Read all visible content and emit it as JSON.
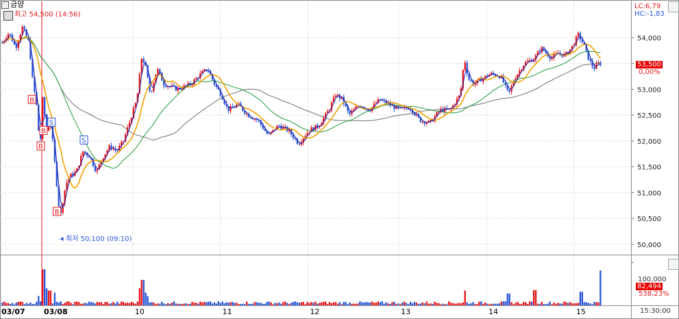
{
  "symbol": "금양",
  "high_label": "최고 54,500 (14:56)",
  "low_label": "최저 50,100 (09:10)",
  "lc_label": "LC:6,79",
  "hc_label": "HC:-1,83",
  "current_price": "53,500",
  "current_change": "0,00%",
  "volume_label": "82,494",
  "volume_ratio": "538,23%",
  "volume_axis_label": "100,000",
  "time_label": "15:30:00",
  "colors": {
    "up": "#e8151a",
    "down": "#2a56d8",
    "ma5": "#1a1aa8",
    "ma20": "#f0a000",
    "ma60": "#1e9a38",
    "ma120": "#707070",
    "grid": "#c6c6c6"
  },
  "chart_data": {
    "type": "candlestick",
    "title": "금양",
    "y_ticks": [
      "54,000",
      "53,500",
      "53,000",
      "52,500",
      "52,000",
      "51,500",
      "51,000",
      "50,500",
      "50,000"
    ],
    "y_values": [
      54000,
      53500,
      53000,
      52500,
      52000,
      51500,
      51000,
      50500,
      50000
    ],
    "ylim": [
      49800,
      54700
    ],
    "x_tick_labels": [
      "03/07",
      "03/08",
      "10",
      "11",
      "12",
      "13",
      "14",
      "15"
    ],
    "x_tick_times": [
      0,
      60,
      195,
      325,
      455,
      590,
      720,
      850
    ],
    "x_max": 900,
    "price_anchors": [
      [
        0,
        53900
      ],
      [
        10,
        54100
      ],
      [
        20,
        53800
      ],
      [
        30,
        54200
      ],
      [
        40,
        53900
      ],
      [
        45,
        53200
      ],
      [
        52,
        52600
      ],
      [
        56,
        51800
      ],
      [
        60,
        52800
      ],
      [
        66,
        52200
      ],
      [
        72,
        52400
      ],
      [
        80,
        51300
      ],
      [
        86,
        50500
      ],
      [
        92,
        51000
      ],
      [
        98,
        51300
      ],
      [
        110,
        51400
      ],
      [
        120,
        51800
      ],
      [
        130,
        51700
      ],
      [
        140,
        51400
      ],
      [
        150,
        51700
      ],
      [
        160,
        51900
      ],
      [
        170,
        51800
      ],
      [
        180,
        52000
      ],
      [
        190,
        52400
      ],
      [
        200,
        52800
      ],
      [
        207,
        53600
      ],
      [
        212,
        53500
      ],
      [
        220,
        52900
      ],
      [
        230,
        53400
      ],
      [
        240,
        53100
      ],
      [
        260,
        53000
      ],
      [
        280,
        53100
      ],
      [
        295,
        53300
      ],
      [
        305,
        53400
      ],
      [
        315,
        53100
      ],
      [
        325,
        52900
      ],
      [
        335,
        52600
      ],
      [
        350,
        52700
      ],
      [
        365,
        52500
      ],
      [
        380,
        52400
      ],
      [
        395,
        52100
      ],
      [
        410,
        52300
      ],
      [
        425,
        52200
      ],
      [
        440,
        51950
      ],
      [
        455,
        52200
      ],
      [
        470,
        52300
      ],
      [
        485,
        52600
      ],
      [
        495,
        52900
      ],
      [
        505,
        52800
      ],
      [
        515,
        52500
      ],
      [
        530,
        52700
      ],
      [
        545,
        52600
      ],
      [
        560,
        52800
      ],
      [
        575,
        52700
      ],
      [
        590,
        52600
      ],
      [
        605,
        52650
      ],
      [
        620,
        52400
      ],
      [
        635,
        52350
      ],
      [
        650,
        52600
      ],
      [
        665,
        52600
      ],
      [
        680,
        52900
      ],
      [
        686,
        53600
      ],
      [
        692,
        53200
      ],
      [
        700,
        53100
      ],
      [
        712,
        53200
      ],
      [
        725,
        53300
      ],
      [
        740,
        53250
      ],
      [
        752,
        52900
      ],
      [
        760,
        53200
      ],
      [
        775,
        53500
      ],
      [
        790,
        53600
      ],
      [
        800,
        53800
      ],
      [
        815,
        53600
      ],
      [
        825,
        53700
      ],
      [
        835,
        53650
      ],
      [
        845,
        53800
      ],
      [
        855,
        54050
      ],
      [
        862,
        53900
      ],
      [
        870,
        53600
      ],
      [
        878,
        53400
      ],
      [
        885,
        53500
      ],
      [
        890,
        53500
      ]
    ],
    "high_point": {
      "t": 856,
      "price": 54500
    },
    "low_point": {
      "t": 86,
      "price": 50100
    },
    "signals": [
      {
        "t": 45,
        "type": "B"
      },
      {
        "t": 58,
        "type": "B"
      },
      {
        "t": 74,
        "type": "S"
      },
      {
        "t": 62,
        "type": "B"
      },
      {
        "t": 82,
        "type": "B"
      },
      {
        "t": 122,
        "type": "S"
      }
    ],
    "volume_ylim": [
      0,
      110000
    ],
    "volume_spikes": [
      [
        62,
        85000
      ],
      [
        60,
        55000
      ],
      [
        66,
        40000
      ],
      [
        70,
        35000
      ],
      [
        78,
        30000
      ],
      [
        54,
        22000
      ],
      [
        208,
        60000
      ],
      [
        205,
        40000
      ],
      [
        212,
        30000
      ],
      [
        215,
        22000
      ],
      [
        687,
        35000
      ],
      [
        752,
        28000
      ],
      [
        790,
        36000
      ],
      [
        860,
        32000
      ],
      [
        889,
        82494
      ]
    ],
    "moving_averages": [
      "MA5",
      "MA20",
      "MA60",
      "MA120"
    ]
  }
}
